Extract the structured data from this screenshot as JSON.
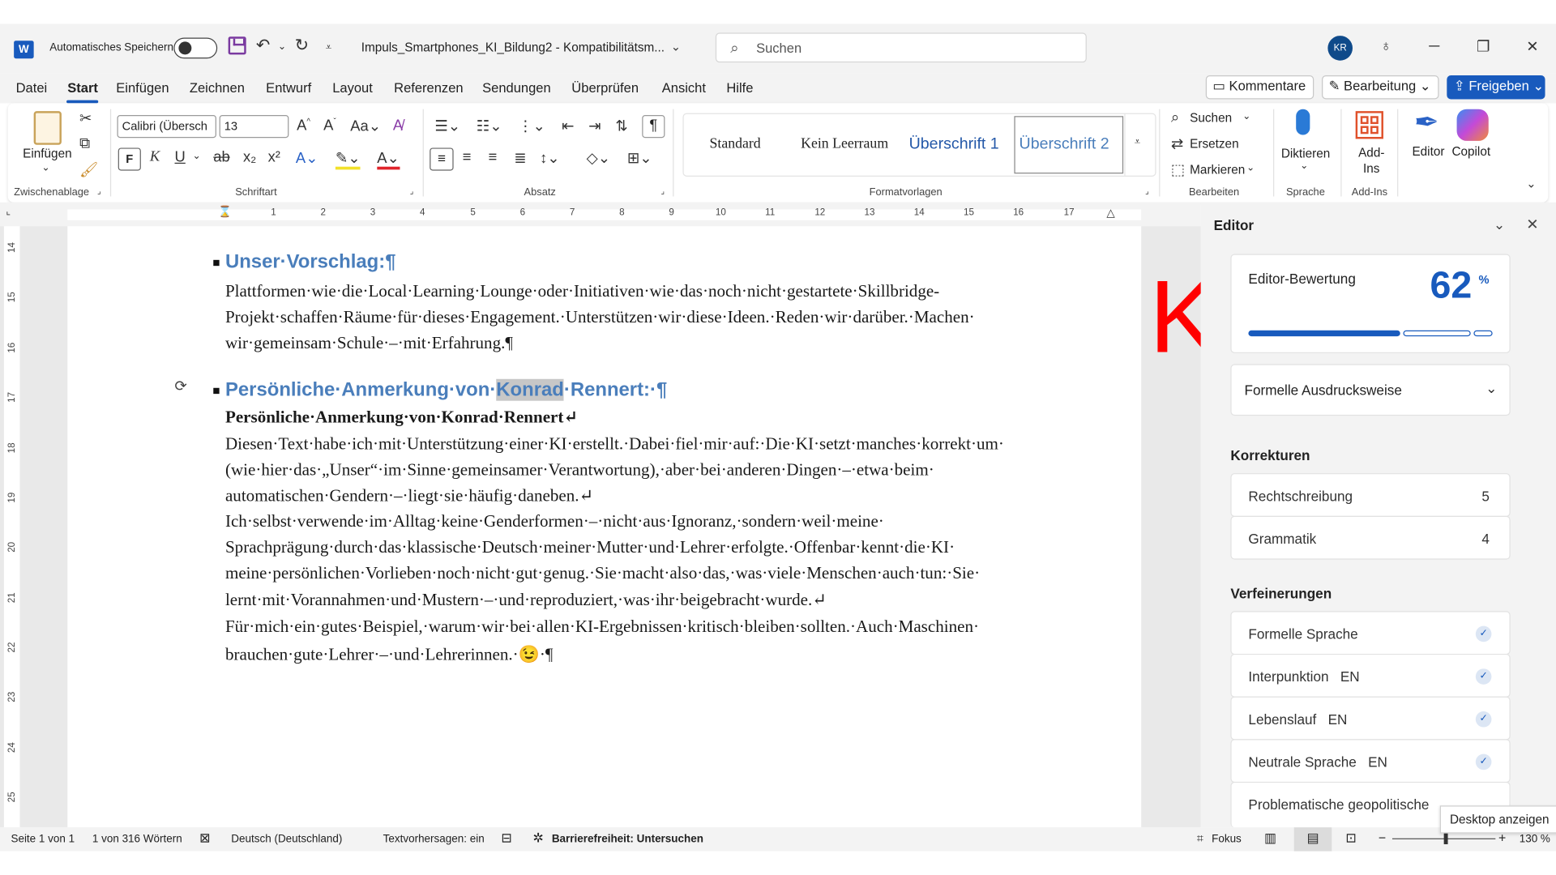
{
  "app": {
    "autosave_label": "Automatisches Speichern",
    "doc_title": "Impuls_Smartphones_KI_Bildung2  -  Kompatibilitätsm...",
    "search_placeholder": "Suchen",
    "user_initials": "KR"
  },
  "menu": {
    "items": [
      "Datei",
      "Start",
      "Einfügen",
      "Zeichnen",
      "Entwurf",
      "Layout",
      "Referenzen",
      "Sendungen",
      "Überprüfen",
      "Ansicht",
      "Hilfe"
    ],
    "active": "Start",
    "comments": "Kommentare",
    "editing": "Bearbeitung",
    "share": "Freigeben"
  },
  "ribbon": {
    "clipboard": {
      "paste": "Einfügen",
      "group": "Zwischenablage"
    },
    "font": {
      "name": "Calibri (Übersch",
      "size": "13",
      "group": "Schriftart",
      "bold": "F",
      "italic": "K",
      "underline": "U"
    },
    "paragraph": {
      "group": "Absatz"
    },
    "styles": {
      "items": [
        "Standard",
        "Kein Leerraum",
        "Überschrift 1",
        "Überschrift 2"
      ],
      "selected": "Überschrift 2",
      "group": "Formatvorlagen"
    },
    "editing": {
      "find": "Suchen",
      "replace": "Ersetzen",
      "select": "Markieren",
      "group": "Bearbeiten"
    },
    "voice": {
      "dictate": "Diktieren",
      "group": "Sprache"
    },
    "addins": {
      "label": "Add-Ins",
      "group": "Add-Ins"
    },
    "editor": "Editor",
    "copilot": "Copilot"
  },
  "ruler": {
    "h_ticks": [
      "1",
      "2",
      "3",
      "4",
      "5",
      "6",
      "7",
      "8",
      "9",
      "10",
      "11",
      "12",
      "13",
      "14",
      "15",
      "16",
      "17"
    ],
    "v_ticks": [
      "14",
      "15",
      "16",
      "17",
      "18",
      "19",
      "20",
      "21",
      "22",
      "23",
      "24",
      "25"
    ]
  },
  "document": {
    "heading1": "Unser·Vorschlag:¶",
    "para1": [
      "Plattformen·wie·die·Local·Learning·Lounge·oder·Initiativen·wie·das·noch·nicht·gestartete·Skillbridge-",
      "Projekt·schaffen·Räume·für·dieses·Engagement.·Unterstützen·wir·diese·Ideen.·Reden·wir·darüber.·Machen·",
      "wir·gemeinsam·Schule·–·mit·Erfahrung.¶"
    ],
    "heading2_pre": "Persönliche·Anmerkung·von·",
    "heading2_hl": "Konrad",
    "heading2_post": "·Rennert:·¶",
    "bold_line": "Persönliche·Anmerkung·von·Konrad·Rennert↵",
    "para2": [
      "Diesen·Text·habe·ich·mit·Unterstützung·einer·KI·erstellt.·Dabei·fiel·mir·auf:·Die·KI·setzt·manches·korrekt·um·",
      "(wie·hier·das·„Unser“·im·Sinne·gemeinsamer·Verantwortung),·aber·bei·anderen·Dingen·–·etwa·beim·",
      "automatischen·Gendern·–·liegt·sie·häufig·daneben.↵",
      "Ich·selbst·verwende·im·Alltag·keine·Genderformen·–·nicht·aus·Ignoranz,·sondern·weil·meine·",
      "Sprachprägung·durch·das·klassische·Deutsch·meiner·Mutter·und·Lehrer·erfolgte.·Offenbar·kennt·die·KI·",
      "meine·persönlichen·Vorlieben·noch·nicht·gut·genug.·Sie·macht·also·das,·was·viele·Menschen·auch·tun:·Sie·",
      "lernt·mit·Vorannahmen·und·Mustern·–·und·reproduziert,·was·ihr·beigebracht·wurde.↵",
      "Für·mich·ein·gutes·Beispiel,·warum·wir·bei·allen·KI-Ergebnissen·kritisch·bleiben·sollten.·Auch·Maschinen·",
      "brauchen·gute·Lehrer·–·und·Lehrerinnen.·😉·¶"
    ]
  },
  "overlay": {
    "ki_mark": "KI"
  },
  "editor_pane": {
    "title": "Editor",
    "score_label": "Editor-Bewertung",
    "score": "62",
    "score_unit": "%",
    "score_fraction": 0.62,
    "mode": "Formelle Ausdrucksweise",
    "corrections_title": "Korrekturen",
    "corrections": [
      {
        "label": "Rechtschreibung",
        "count": "5"
      },
      {
        "label": "Grammatik",
        "count": "4"
      }
    ],
    "refinements_title": "Verfeinerungen",
    "refinements": [
      {
        "label": "Formelle Sprache",
        "lang": ""
      },
      {
        "label": "Interpunktion",
        "lang": "EN"
      },
      {
        "label": "Lebenslauf",
        "lang": "EN"
      },
      {
        "label": "Neutrale Sprache",
        "lang": "EN"
      },
      {
        "label": "Problematische geopolitische",
        "lang": ""
      }
    ]
  },
  "status": {
    "page": "Seite 1 von 1",
    "words": "1 von 316 Wörtern",
    "language": "Deutsch (Deutschland)",
    "predictions": "Textvorhersagen: ein",
    "accessibility": "Barrierefreiheit: Untersuchen",
    "focus": "Fokus",
    "zoom": "130 %"
  },
  "tooltip": "Desktop anzeigen",
  "colors": {
    "accent": "#185abd",
    "heading": "#4a7ebb",
    "ki": "#ff0000"
  }
}
